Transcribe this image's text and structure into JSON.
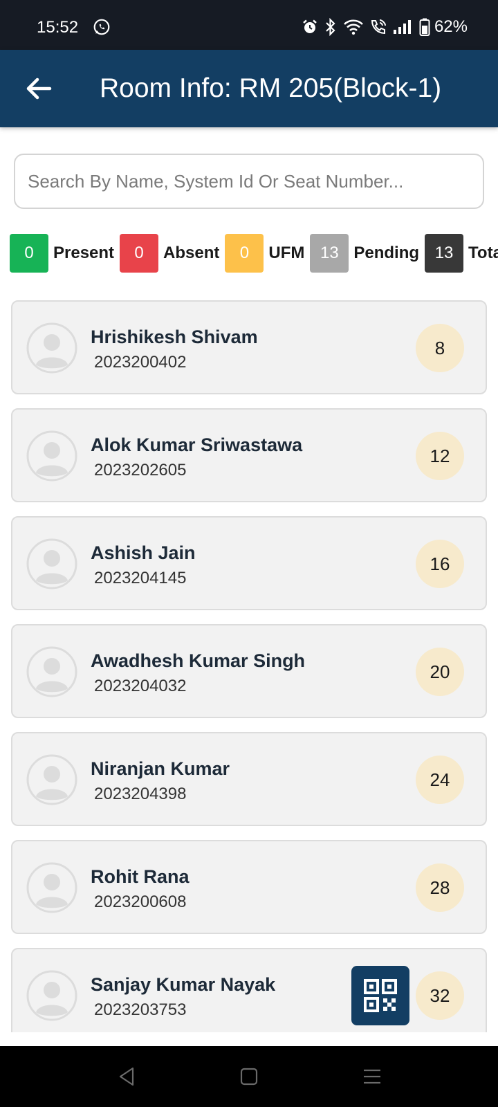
{
  "status_bar": {
    "time": "15:52",
    "battery": "62%",
    "icons": [
      "whatsapp-icon",
      "alarm-icon",
      "bluetooth-icon",
      "wifi-icon",
      "wifi-call-icon",
      "signal-icon",
      "battery-icon"
    ]
  },
  "app_bar": {
    "title": "Room Info: RM 205(Block-1)",
    "back_icon": "arrow-left-icon",
    "background": "#133e63"
  },
  "search": {
    "placeholder": "Search By Name, System Id Or Seat Number...",
    "value": ""
  },
  "stats": [
    {
      "label": "Present",
      "count": "0",
      "color": "#17b356"
    },
    {
      "label": "Absent",
      "count": "0",
      "color": "#e8434a"
    },
    {
      "label": "UFM",
      "count": "0",
      "color": "#fdc14a"
    },
    {
      "label": "Pending",
      "count": "13",
      "color": "#a8a8a8"
    },
    {
      "label": "Total",
      "count": "13",
      "color": "#383838"
    }
  ],
  "students": [
    {
      "name": "Hrishikesh Shivam",
      "system_id": "2023200402",
      "seat": "8"
    },
    {
      "name": "Alok Kumar Sriwastawa",
      "system_id": "2023202605",
      "seat": "12"
    },
    {
      "name": "Ashish Jain",
      "system_id": "2023204145",
      "seat": "16"
    },
    {
      "name": "Awadhesh Kumar Singh",
      "system_id": "2023204032",
      "seat": "20"
    },
    {
      "name": "Niranjan Kumar",
      "system_id": "2023204398",
      "seat": "24"
    },
    {
      "name": "Rohit Rana",
      "system_id": "2023200608",
      "seat": "28"
    },
    {
      "name": "Sanjay Kumar Nayak",
      "system_id": "2023203753",
      "seat": "32"
    }
  ],
  "fab": {
    "icon": "qr-code-icon"
  },
  "nav_bar": {
    "icons": [
      "back-triangle-icon",
      "home-square-icon",
      "recents-menu-icon"
    ]
  }
}
